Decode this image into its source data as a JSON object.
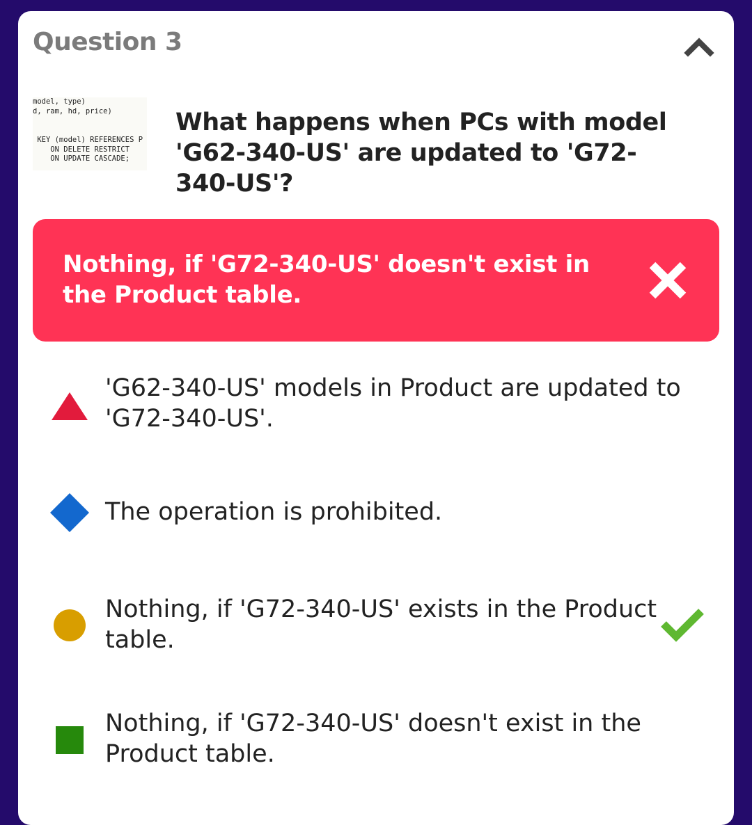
{
  "question": {
    "number_label": "Question 3",
    "text": "What happens when PCs with model 'G62-340-US' are updated to 'G72-340-US'?",
    "code_snippet": "model, type)\nd, ram, hd, price)\n\n\n KEY (model) REFERENCES P\n    ON DELETE RESTRICT\n    ON UPDATE CASCADE;"
  },
  "selected_answer": {
    "text": "Nothing, if 'G72-340-US' doesn't exist in the Product table.",
    "status": "incorrect",
    "color": "#ff3355"
  },
  "options": [
    {
      "shape": "triangle-icon",
      "color": "#e21b3c",
      "text": "'G62-340-US' models in Product are updated to 'G72-340-US'."
    },
    {
      "shape": "diamond-icon",
      "color": "#1368ce",
      "text": "The operation is prohibited."
    },
    {
      "shape": "circle-icon",
      "color": "#d89e00",
      "text": "Nothing, if 'G72-340-US' exists in the Product table.",
      "correct": true
    },
    {
      "shape": "square-icon",
      "color": "#26890c",
      "text": "Nothing, if 'G72-340-US' doesn't exist in the Product table."
    }
  ],
  "colors": {
    "background": "#240b6b",
    "correct_check": "#5fb831"
  }
}
